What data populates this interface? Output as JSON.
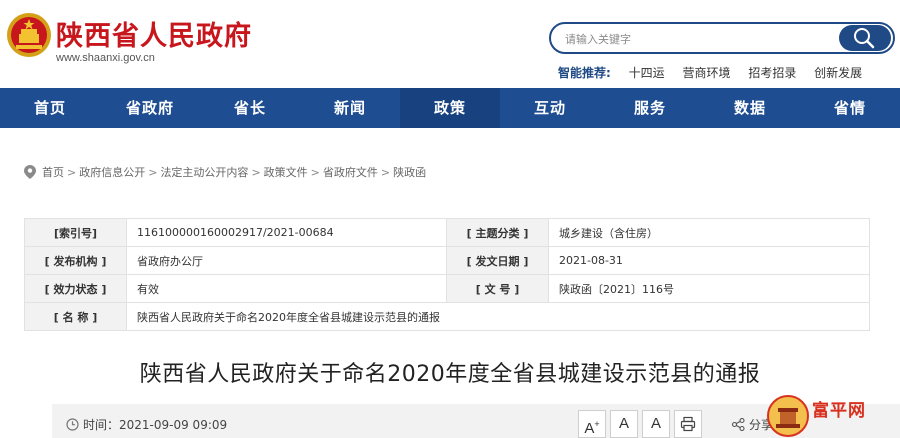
{
  "header": {
    "site_title": "陕西省人民政府",
    "site_domain": "www.shaanxi.gov.cn",
    "search_placeholder": "请输入关键字",
    "smart_label": "智能推荐:",
    "smart_items": [
      "十四运",
      "营商环境",
      "招考招录",
      "创新发展"
    ]
  },
  "nav": {
    "items": [
      "首页",
      "省政府",
      "省长",
      "新闻",
      "政策",
      "互动",
      "服务",
      "数据",
      "省情"
    ],
    "active": "政策"
  },
  "breadcrumb": [
    "首页",
    "政府信息公开",
    "法定主动公开内容",
    "政策文件",
    "省政府文件",
    "陕政函"
  ],
  "meta": {
    "index_label": "[索引号]",
    "index_value": "116100000160002917/2021-00684",
    "topic_label": "[ 主题分类 ]",
    "topic_value": "城乡建设（含住房）",
    "issuer_label": "[ 发布机构 ]",
    "issuer_value": "省政府办公厅",
    "date_label": "[ 发文日期 ]",
    "date_value": "2021-08-31",
    "status_label": "[ 效力状态 ]",
    "status_value": "有效",
    "docno_label": "[ 文 号 ]",
    "docno_value": "陕政函〔2021〕116号",
    "name_label": "[ 名 称 ]",
    "name_value": "陕西省人民政府关于命名2020年度全省县城建设示范县的通报"
  },
  "article": {
    "title": "陕西省人民政府关于命名2020年度全省县城建设示范县的通报"
  },
  "toolbar": {
    "time": "时间：2021-09-09 09:09",
    "font_large": "A",
    "font_large_sup": "+",
    "font_medium": "A",
    "font_small": "A",
    "share": "分享"
  },
  "watermark": {
    "text": "富平网"
  },
  "colors": {
    "brand_red": "#c8161d",
    "nav_blue": "#1e4d91",
    "nav_active": "#17427f"
  }
}
